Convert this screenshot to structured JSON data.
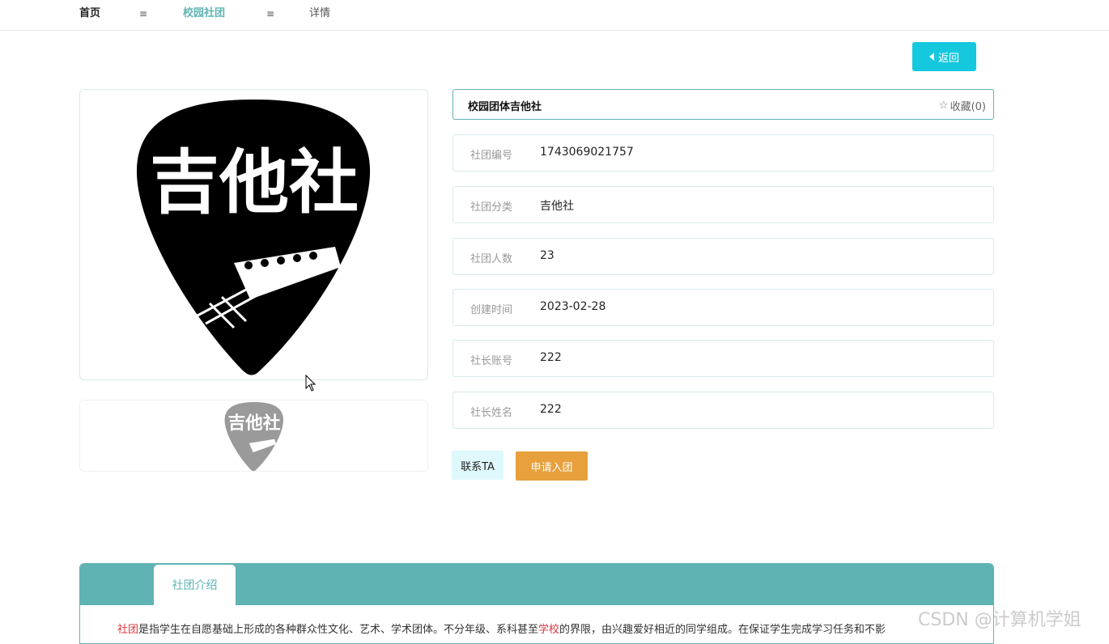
{
  "breadcrumb": {
    "home": "首页",
    "separator": "≡",
    "section": "校园社团",
    "current": "详情"
  },
  "back_button": {
    "label": "返回"
  },
  "club": {
    "name": "校园团体吉他社",
    "favorite_label": "收藏(0)",
    "fields": [
      {
        "label": "社团编号",
        "value": "1743069021757"
      },
      {
        "label": "社团分类",
        "value": "吉他社"
      },
      {
        "label": "社团人数",
        "value": "23"
      },
      {
        "label": "创建时间",
        "value": "2023-02-28"
      },
      {
        "label": "社长账号",
        "value": "222"
      },
      {
        "label": "社长姓名",
        "value": "222"
      }
    ],
    "logo_text": "吉他社"
  },
  "actions": {
    "contact": "联系TA",
    "apply": "申请入团"
  },
  "tabs": [
    {
      "label": "社团介绍"
    }
  ],
  "intro": {
    "word1": "社团",
    "part1": "是指学生在自愿基础上形成的各种群众性文化、艺术、学术团体。不分年级、系科甚至",
    "word2": "学校",
    "part2": "的界限，由兴趣爱好相近的同学组成。在保证学生完成学习任务和不影"
  },
  "watermark": "CSDN @计算机学姐",
  "colors": {
    "accent": "#5fb3b3",
    "back_button": "#16c8de",
    "apply_button": "#e7a03c",
    "contact_button": "#dff8fb",
    "highlight_text": "#d9363e"
  },
  "icons": {
    "back": "triangle-left-icon",
    "favorite": "star-outline-icon",
    "cursor": "mouse-pointer-icon"
  }
}
